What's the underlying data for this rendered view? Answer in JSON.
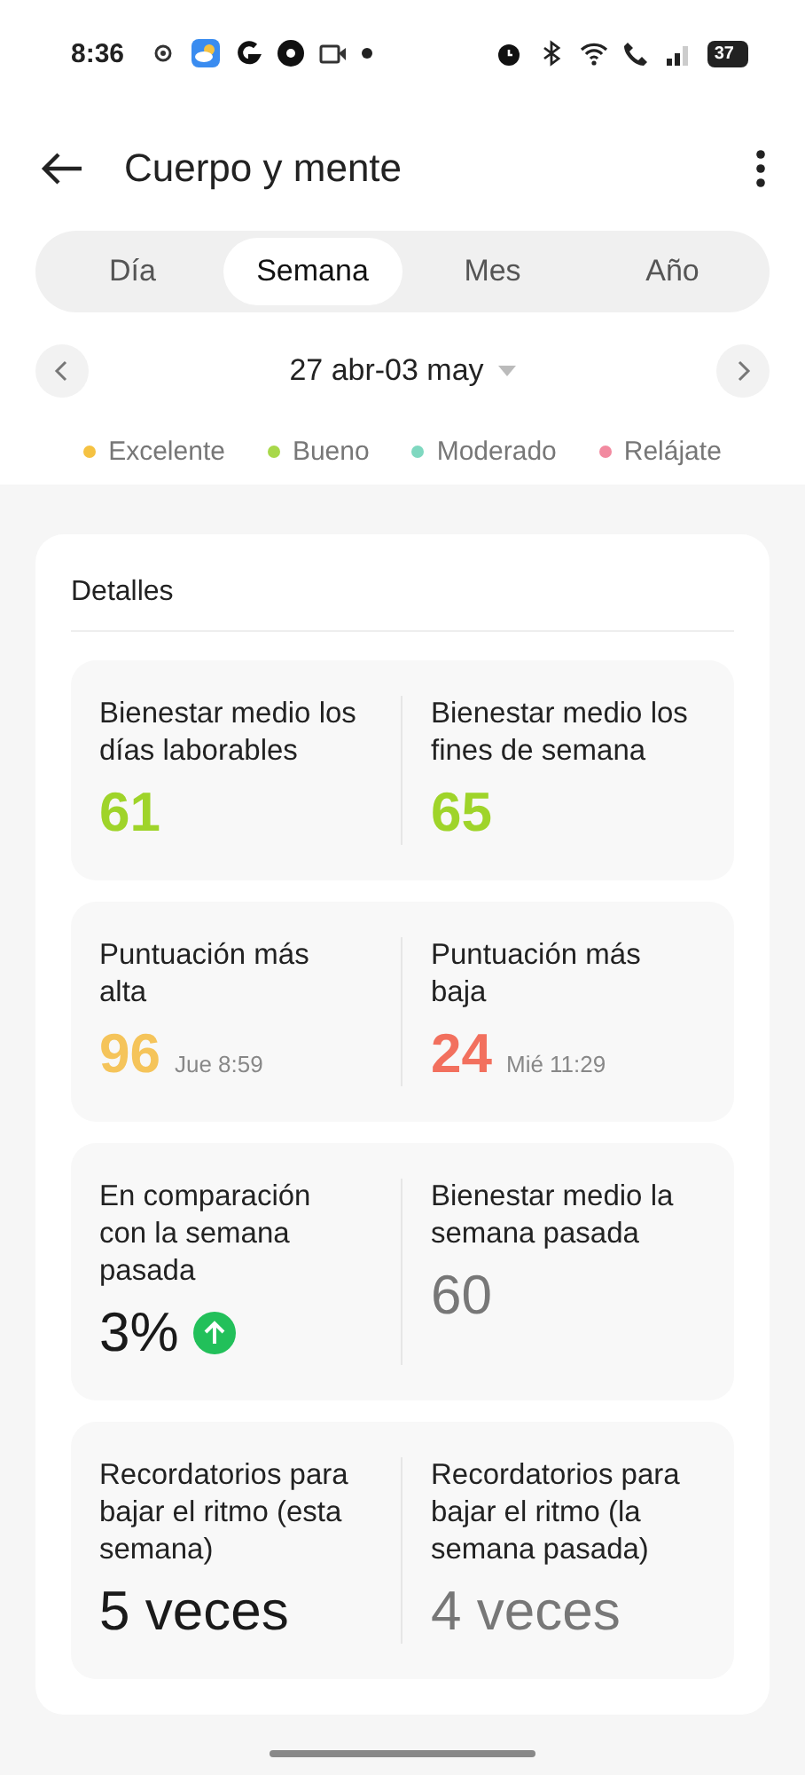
{
  "status_bar": {
    "time": "8:36",
    "battery": "37"
  },
  "header": {
    "title": "Cuerpo y mente"
  },
  "tabs": [
    {
      "label": "Día",
      "selected": false
    },
    {
      "label": "Semana",
      "selected": true
    },
    {
      "label": "Mes",
      "selected": false
    },
    {
      "label": "Año",
      "selected": false
    }
  ],
  "date_range": {
    "label": "27 abr-03 may"
  },
  "legend": [
    {
      "label": "Excelente",
      "color": "#f5c242"
    },
    {
      "label": "Bueno",
      "color": "#a8d84a"
    },
    {
      "label": "Moderado",
      "color": "#7fd8c0"
    },
    {
      "label": "Relájate",
      "color": "#f28aa0"
    }
  ],
  "details": {
    "title": "Detalles",
    "blocks": [
      {
        "cells": [
          {
            "kind": "plain",
            "label": "Bienestar medio los días laborables",
            "value": "61",
            "color": "#9fd42a"
          },
          {
            "kind": "plain",
            "label": "Bienestar medio los fines de semana",
            "value": "65",
            "color": "#9fd42a"
          }
        ]
      },
      {
        "cells": [
          {
            "kind": "plain",
            "label": "Puntuación más alta",
            "value": "96",
            "note": "Jue 8:59",
            "color": "#f5c45a"
          },
          {
            "kind": "plain",
            "label": "Puntuación más baja",
            "value": "24",
            "note": "Mié 11:29",
            "color": "#f2705e"
          }
        ]
      },
      {
        "cells": [
          {
            "kind": "rise",
            "label": "En comparación con la semana pasada",
            "value": "3%",
            "color": "#1a1a1a"
          },
          {
            "kind": "plain",
            "label": "Bienestar medio la semana pasada",
            "value": "60",
            "color": "#777777"
          }
        ]
      },
      {
        "cells": [
          {
            "kind": "plain",
            "label": "Recordatorios para bajar el ritmo (esta semana)",
            "value": "5 veces",
            "color": "#1a1a1a"
          },
          {
            "kind": "plain",
            "label": "Recordatorios para bajar el ritmo (la semana pasada)",
            "value": "4 veces",
            "color": "#777777"
          }
        ]
      }
    ]
  }
}
